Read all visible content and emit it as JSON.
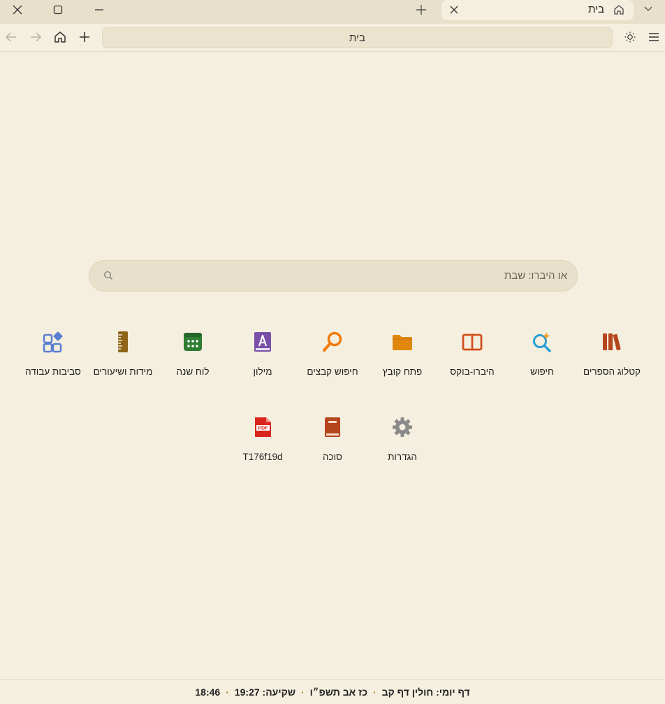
{
  "window": {
    "tab_title": "בית",
    "tab_icon": "home-icon",
    "address": "בית"
  },
  "search": {
    "placeholder": "או היברו: שבת"
  },
  "tiles": [
    {
      "label": "קטלוג הספרים",
      "icon": "books-icon",
      "color": "#b5451b"
    },
    {
      "label": "חיפוש",
      "icon": "ai-search-icon",
      "color": "#2a9fd8"
    },
    {
      "label": "היברו-בוקס",
      "icon": "open-book-icon",
      "color": "#d2501f"
    },
    {
      "label": "פתח קובץ",
      "icon": "folder-icon",
      "color": "#e0880e"
    },
    {
      "label": "חיפוש קבצים",
      "icon": "magnifier-icon",
      "color": "#f07b0a"
    },
    {
      "label": "מילון",
      "icon": "dictionary-icon",
      "color": "#7a4fa8"
    },
    {
      "label": "לוח שנה",
      "icon": "calendar-icon",
      "color": "#2f7d32"
    },
    {
      "label": "מידות ושיעורים",
      "icon": "ruler-icon",
      "color": "#8d6418"
    },
    {
      "label": "סביבות עבודה",
      "icon": "workspaces-icon",
      "color": "#5b7fd1"
    },
    {
      "label": "הגדרות",
      "icon": "gear-icon",
      "color": "#8a8a8a"
    },
    {
      "label": "סוכה",
      "icon": "book-icon",
      "color": "#b5451b"
    },
    {
      "label": "T176f19d",
      "icon": "pdf-icon",
      "color": "#d9251c"
    }
  ],
  "status": {
    "time": "18:46",
    "sunset": "שקיעה: 19:27",
    "hebrew_date": "כז אב תשפ״ו",
    "daf_yomi": "דף יומי: חולין דף קב"
  }
}
